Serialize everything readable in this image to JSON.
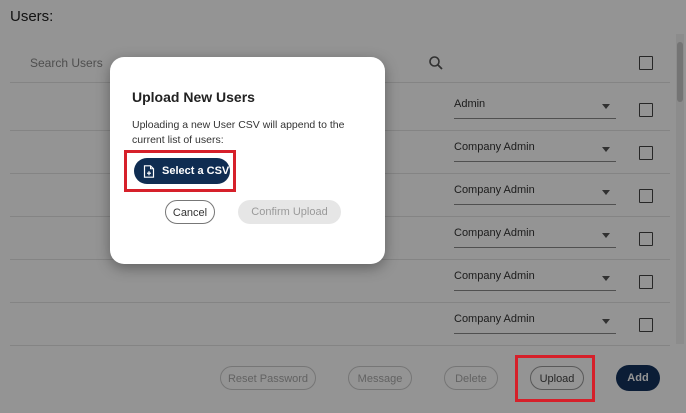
{
  "page": {
    "title": "Users:"
  },
  "search": {
    "placeholder": "Search Users"
  },
  "rows": [
    {
      "role": "Admin"
    },
    {
      "role": "Company Admin"
    },
    {
      "role": "Company Admin"
    },
    {
      "role": "Company Admin"
    },
    {
      "role": "Company Admin"
    },
    {
      "role": "Company Admin"
    }
  ],
  "actions": {
    "reset_password": "Reset Password",
    "message": "Message",
    "delete": "Delete",
    "upload": "Upload",
    "add": "Add"
  },
  "modal": {
    "title": "Upload New Users",
    "text": "Uploading a new User CSV will append to the current list of users:",
    "select_csv": "Select a CSV",
    "cancel": "Cancel",
    "confirm_upload": "Confirm Upload"
  },
  "colors": {
    "primary": "#13335e",
    "highlight": "#d6202a"
  }
}
